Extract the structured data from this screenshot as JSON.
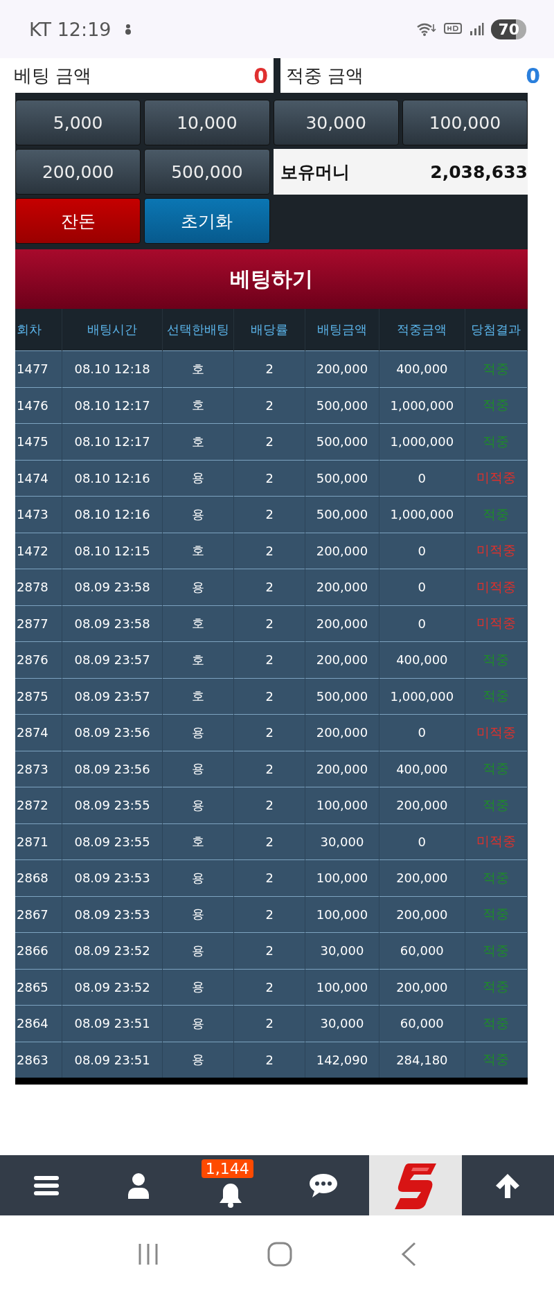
{
  "status_bar": {
    "carrier_time": "KT 12:19",
    "battery": "70"
  },
  "amounts": [
    {
      "label": "베팅 금액",
      "value": "0",
      "kind": "bet"
    },
    {
      "label": "적중 금액",
      "value": "0",
      "kind": "win"
    }
  ],
  "chip_buttons": [
    "5,000",
    "10,000",
    "30,000",
    "100,000",
    "200,000",
    "500,000"
  ],
  "balance": {
    "label": "보유머니",
    "value": "2,038,633"
  },
  "action_buttons": [
    {
      "label": "잔돈",
      "kind": "red"
    },
    {
      "label": "초기화",
      "kind": "blue"
    }
  ],
  "bet_button": "베팅하기",
  "table": {
    "columns": [
      "회차",
      "배팅시간",
      "선택한배팅",
      "배당률",
      "배팅금액",
      "적중금액",
      "당첨결과"
    ],
    "rows": [
      {
        "round": "1477",
        "time": "08.10 12:18",
        "pick": "호",
        "odds": "2",
        "bet": "200,000",
        "payout": "400,000",
        "result": "적중",
        "kind": "win"
      },
      {
        "round": "1476",
        "time": "08.10 12:17",
        "pick": "호",
        "odds": "2",
        "bet": "500,000",
        "payout": "1,000,000",
        "result": "적중",
        "kind": "win"
      },
      {
        "round": "1475",
        "time": "08.10 12:17",
        "pick": "호",
        "odds": "2",
        "bet": "500,000",
        "payout": "1,000,000",
        "result": "적중",
        "kind": "win"
      },
      {
        "round": "1474",
        "time": "08.10 12:16",
        "pick": "용",
        "odds": "2",
        "bet": "500,000",
        "payout": "0",
        "result": "미적중",
        "kind": "lose"
      },
      {
        "round": "1473",
        "time": "08.10 12:16",
        "pick": "용",
        "odds": "2",
        "bet": "500,000",
        "payout": "1,000,000",
        "result": "적중",
        "kind": "win"
      },
      {
        "round": "1472",
        "time": "08.10 12:15",
        "pick": "호",
        "odds": "2",
        "bet": "200,000",
        "payout": "0",
        "result": "미적중",
        "kind": "lose"
      },
      {
        "round": "2878",
        "time": "08.09 23:58",
        "pick": "용",
        "odds": "2",
        "bet": "200,000",
        "payout": "0",
        "result": "미적중",
        "kind": "lose"
      },
      {
        "round": "2877",
        "time": "08.09 23:58",
        "pick": "호",
        "odds": "2",
        "bet": "200,000",
        "payout": "0",
        "result": "미적중",
        "kind": "lose"
      },
      {
        "round": "2876",
        "time": "08.09 23:57",
        "pick": "호",
        "odds": "2",
        "bet": "200,000",
        "payout": "400,000",
        "result": "적중",
        "kind": "win"
      },
      {
        "round": "2875",
        "time": "08.09 23:57",
        "pick": "호",
        "odds": "2",
        "bet": "500,000",
        "payout": "1,000,000",
        "result": "적중",
        "kind": "win"
      },
      {
        "round": "2874",
        "time": "08.09 23:56",
        "pick": "용",
        "odds": "2",
        "bet": "200,000",
        "payout": "0",
        "result": "미적중",
        "kind": "lose"
      },
      {
        "round": "2873",
        "time": "08.09 23:56",
        "pick": "용",
        "odds": "2",
        "bet": "200,000",
        "payout": "400,000",
        "result": "적중",
        "kind": "win"
      },
      {
        "round": "2872",
        "time": "08.09 23:55",
        "pick": "용",
        "odds": "2",
        "bet": "100,000",
        "payout": "200,000",
        "result": "적중",
        "kind": "win"
      },
      {
        "round": "2871",
        "time": "08.09 23:55",
        "pick": "호",
        "odds": "2",
        "bet": "30,000",
        "payout": "0",
        "result": "미적중",
        "kind": "lose"
      },
      {
        "round": "2868",
        "time": "08.09 23:53",
        "pick": "용",
        "odds": "2",
        "bet": "100,000",
        "payout": "200,000",
        "result": "적중",
        "kind": "win"
      },
      {
        "round": "2867",
        "time": "08.09 23:53",
        "pick": "용",
        "odds": "2",
        "bet": "100,000",
        "payout": "200,000",
        "result": "적중",
        "kind": "win"
      },
      {
        "round": "2866",
        "time": "08.09 23:52",
        "pick": "용",
        "odds": "2",
        "bet": "30,000",
        "payout": "60,000",
        "result": "적중",
        "kind": "win"
      },
      {
        "round": "2865",
        "time": "08.09 23:52",
        "pick": "용",
        "odds": "2",
        "bet": "100,000",
        "payout": "200,000",
        "result": "적중",
        "kind": "win"
      },
      {
        "round": "2864",
        "time": "08.09 23:51",
        "pick": "용",
        "odds": "2",
        "bet": "30,000",
        "payout": "60,000",
        "result": "적중",
        "kind": "win"
      },
      {
        "round": "2863",
        "time": "08.09 23:51",
        "pick": "용",
        "odds": "2",
        "bet": "142,090",
        "payout": "284,180",
        "result": "적중",
        "kind": "win"
      }
    ]
  },
  "bottom_nav": {
    "notification_badge": "1,144"
  }
}
